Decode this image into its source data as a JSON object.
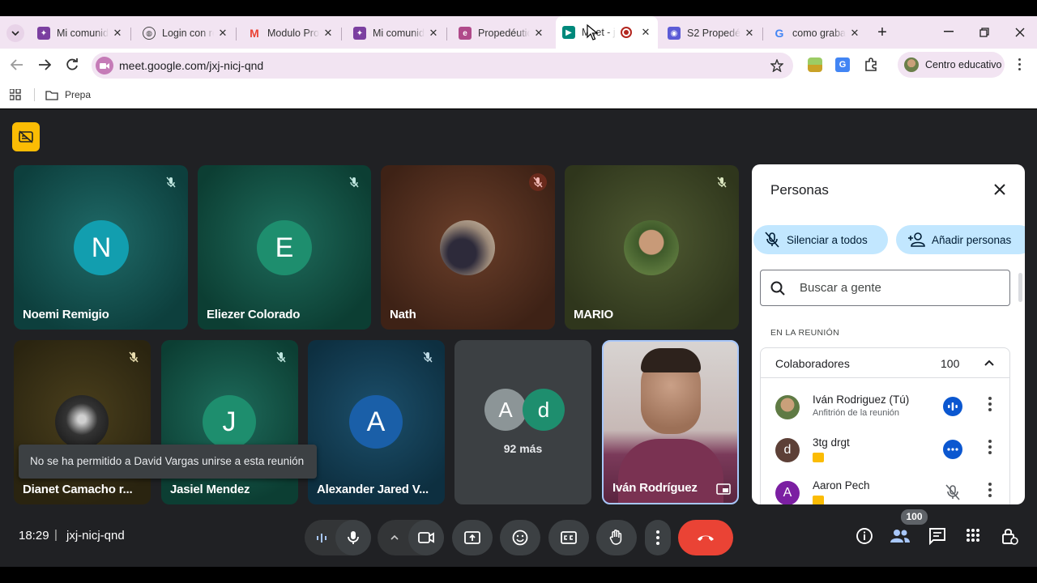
{
  "browser": {
    "tabs": [
      {
        "title": "Mi comunidad"
      },
      {
        "title": "Login con re"
      },
      {
        "title": "Modulo Prop"
      },
      {
        "title": "Mi comunidad"
      },
      {
        "title": "Propedéutico"
      },
      {
        "title": "Meet - jxj"
      },
      {
        "title": "S2 Propedéu"
      },
      {
        "title": "como graba"
      }
    ],
    "new_tab": "+",
    "url": "meet.google.com/jxj-nicj-qnd",
    "profile_name": "Centro educativo",
    "bookmark_folder": "Prepa"
  },
  "tiles": [
    {
      "name": "Noemi Remigio",
      "initial": "N"
    },
    {
      "name": "Eliezer Colorado",
      "initial": "E"
    },
    {
      "name": "Nath"
    },
    {
      "name": "MARIO"
    },
    {
      "name": "Dianet Camacho r..."
    },
    {
      "name": "Jasiel Mendez",
      "initial": "J"
    },
    {
      "name": "Alexander Jared V...",
      "initial": "A"
    },
    {
      "more_label": "92 más",
      "initials": [
        "A",
        "d"
      ]
    },
    {
      "name": "Iván Rodríguez"
    }
  ],
  "toast": "No se ha permitido a David Vargas unirse a esta reunión",
  "footer": {
    "time": "18:29",
    "separator": "|",
    "meeting_code": "jxj-nicj-qnd",
    "participant_badge": "100"
  },
  "panel": {
    "title": "Personas",
    "mute_all": "Silenciar a todos",
    "add_people": "Añadir personas",
    "search_placeholder": "Buscar a gente",
    "section": "EN LA REUNIÓN",
    "group_label": "Colaboradores",
    "group_count": "100",
    "people": [
      {
        "name": "Iván Rodriguez (Tú)",
        "sub": "Anfitrión de la reunión"
      },
      {
        "name": "3tg drgt",
        "initial": "d"
      },
      {
        "name": "Aaron Pech",
        "initial": "A"
      }
    ]
  },
  "colors": {
    "accent_blue": "#0b57d0",
    "end_call_red": "#ea4335",
    "panel_pill": "#c2e7ff",
    "tab_bar": "#f2e4f2"
  }
}
